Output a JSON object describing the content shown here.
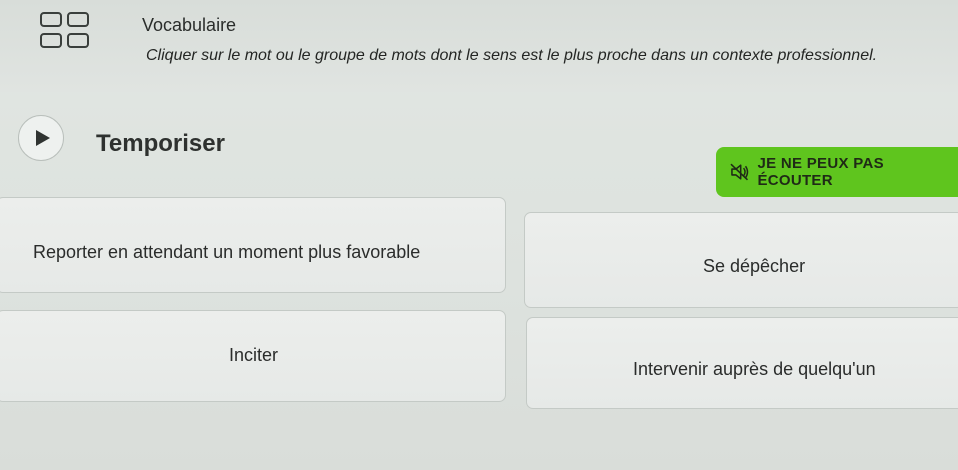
{
  "header": {
    "icon": "grid-icon",
    "title": "Vocabulaire",
    "instruction": "Cliquer sur le mot ou le groupe de mots dont le sens est le plus proche dans un contexte professionnel."
  },
  "question": {
    "play_icon": "play-icon",
    "word": "Temporiser"
  },
  "audio_toggle": {
    "icon": "speaker-muted-icon",
    "label": "JE NE PEUX PAS ÉCOUTER",
    "color": "#5fc51e"
  },
  "options": [
    {
      "label": "Reporter en attendant un moment plus favorable"
    },
    {
      "label": "Se dépêcher"
    },
    {
      "label": "Inciter"
    },
    {
      "label": "Intervenir auprès de quelqu'un"
    }
  ]
}
